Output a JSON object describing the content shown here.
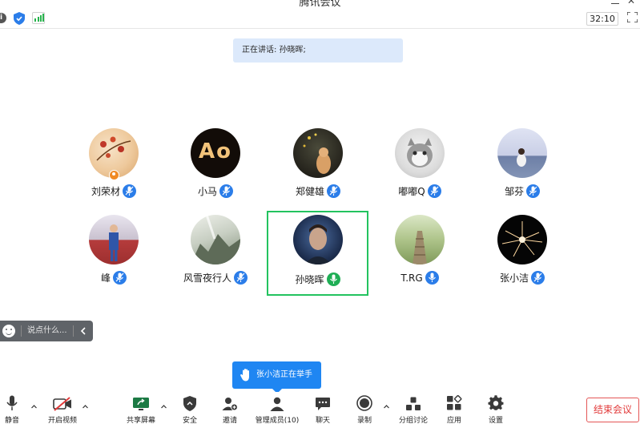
{
  "window": {
    "title": "腾讯会议"
  },
  "topbar": {
    "timer": "32:10"
  },
  "speaking": {
    "text": "正在讲话: 孙晓晖;"
  },
  "participants": [
    {
      "name": "刘荣材"
    },
    {
      "name": "小马"
    },
    {
      "name": "郑健雄"
    },
    {
      "name": "嘟嘟Q"
    },
    {
      "name": "邹芬"
    },
    {
      "name": "峰"
    },
    {
      "name": "风雪夜行人"
    },
    {
      "name": "孙晓晖"
    },
    {
      "name": "T.RG"
    },
    {
      "name": "张小洁"
    }
  ],
  "avatar_text": {
    "xiaoma": "Ao"
  },
  "chat": {
    "placeholder": "说点什么..."
  },
  "notification": {
    "raise_hand": "张小洁正在举手"
  },
  "toolbar": {
    "mute": "静音",
    "video": "开启视频",
    "share": "共享屏幕",
    "security": "安全",
    "invite": "邀请",
    "members": "管理成员(10)",
    "chat": "聊天",
    "record": "录制",
    "breakout": "分组讨论",
    "apps": "应用",
    "settings": "设置",
    "end": "结束会议"
  },
  "colors": {
    "accent": "#1f86f2",
    "mic_blue": "#2b7de9",
    "active_green": "#23c35f",
    "end_red": "#e23b3b"
  }
}
